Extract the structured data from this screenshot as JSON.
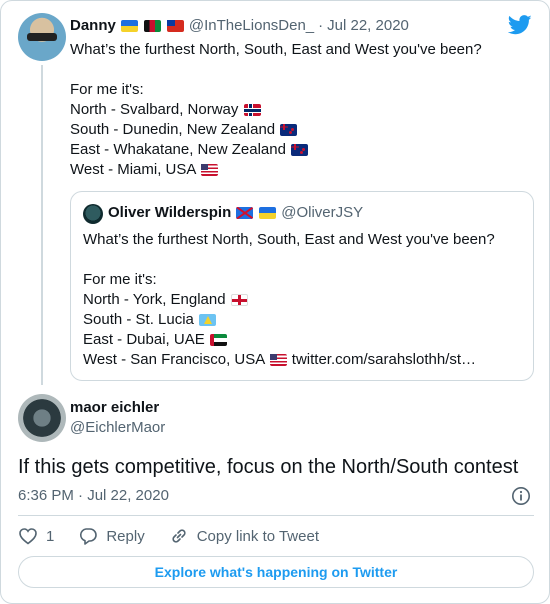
{
  "parent_tweet": {
    "author_name": "Danny",
    "handle": "@InTheLionsDen_",
    "separator": "·",
    "date": "Jul 22, 2020",
    "lines": [
      "What’s the furthest North, South, East and West you've been?",
      "",
      "For me it's:",
      "North - Svalbard, Norway",
      "South - Dunedin, New Zealand",
      "East - Whakatane, New Zealand",
      "West - Miami, USA"
    ]
  },
  "quoted_tweet": {
    "author_name": "Oliver Wilderspin",
    "handle": "@OliverJSY",
    "lines": [
      "What’s the furthest North, South, East and West you've been?",
      "",
      "For me it's:",
      "North - York, England",
      "South - St. Lucia",
      "East - Dubai, UAE",
      "West - San Francisco, USA"
    ],
    "link": "twitter.com/sarahslothh/st…"
  },
  "reply": {
    "author_name": "maor eichler",
    "handle": "@EichlerMaor",
    "text": "If this gets competitive, focus on the North/South contest",
    "timestamp": "6:36 PM · Jul 22, 2020"
  },
  "actions": {
    "like_count": "1",
    "reply_label": "Reply",
    "copy_link_label": "Copy link to Tweet"
  },
  "explore_label": "Explore what's happening on Twitter",
  "colors": {
    "accent": "#1d9bf0",
    "muted": "#536471",
    "border": "#cfd9de"
  }
}
